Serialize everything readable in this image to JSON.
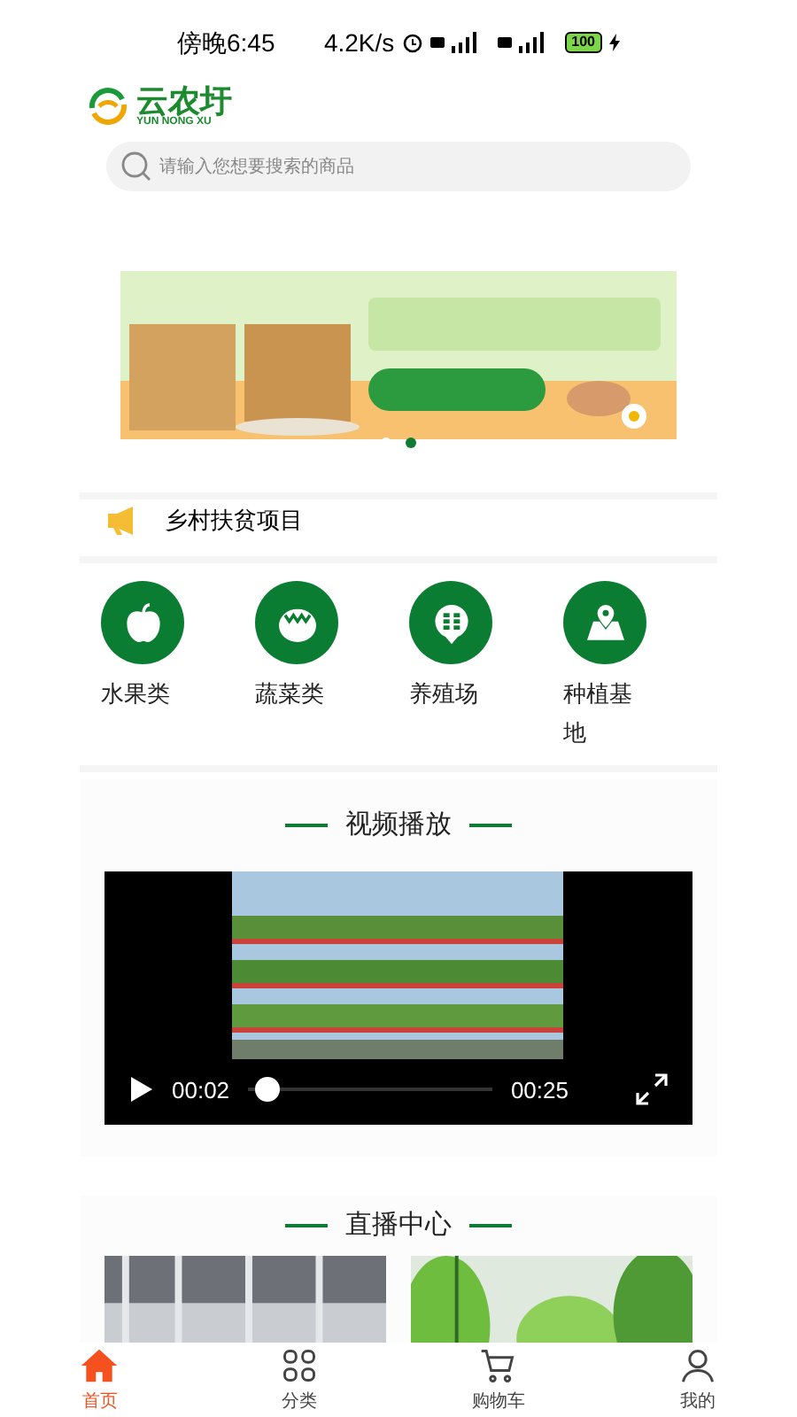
{
  "status_bar": {
    "time": "傍晚6:45",
    "speed": "4.2K/s",
    "battery": "100"
  },
  "logo": {
    "name": "云农圩",
    "subtitle": "YUN NONG XU"
  },
  "search": {
    "placeholder": "请输入您想要搜索的商品"
  },
  "banner": {
    "dots": [
      {
        "selected": false
      },
      {
        "selected": true
      }
    ]
  },
  "notice": {
    "title": "乡村扶贫项目"
  },
  "categories": [
    {
      "label": "水果类",
      "kind": "apple"
    },
    {
      "label": "蔬菜类",
      "kind": "tomato"
    },
    {
      "label": "养殖场",
      "kind": "farm"
    },
    {
      "label": "种植基地",
      "kind": "map"
    }
  ],
  "video": {
    "title": "视频播放",
    "current": "00:02",
    "duration": "00:25",
    "level": 0.08
  },
  "live": {
    "title": "直播中心",
    "items": [
      {
        "kind": "hall"
      },
      {
        "kind": "leaves"
      }
    ]
  },
  "nav": [
    {
      "label": "首页",
      "kind": "home",
      "selected": true
    },
    {
      "label": "分类",
      "kind": "grid",
      "selected": false
    },
    {
      "label": "购物车",
      "kind": "cart",
      "selected": false
    },
    {
      "label": "我的",
      "kind": "user",
      "selected": false
    }
  ]
}
